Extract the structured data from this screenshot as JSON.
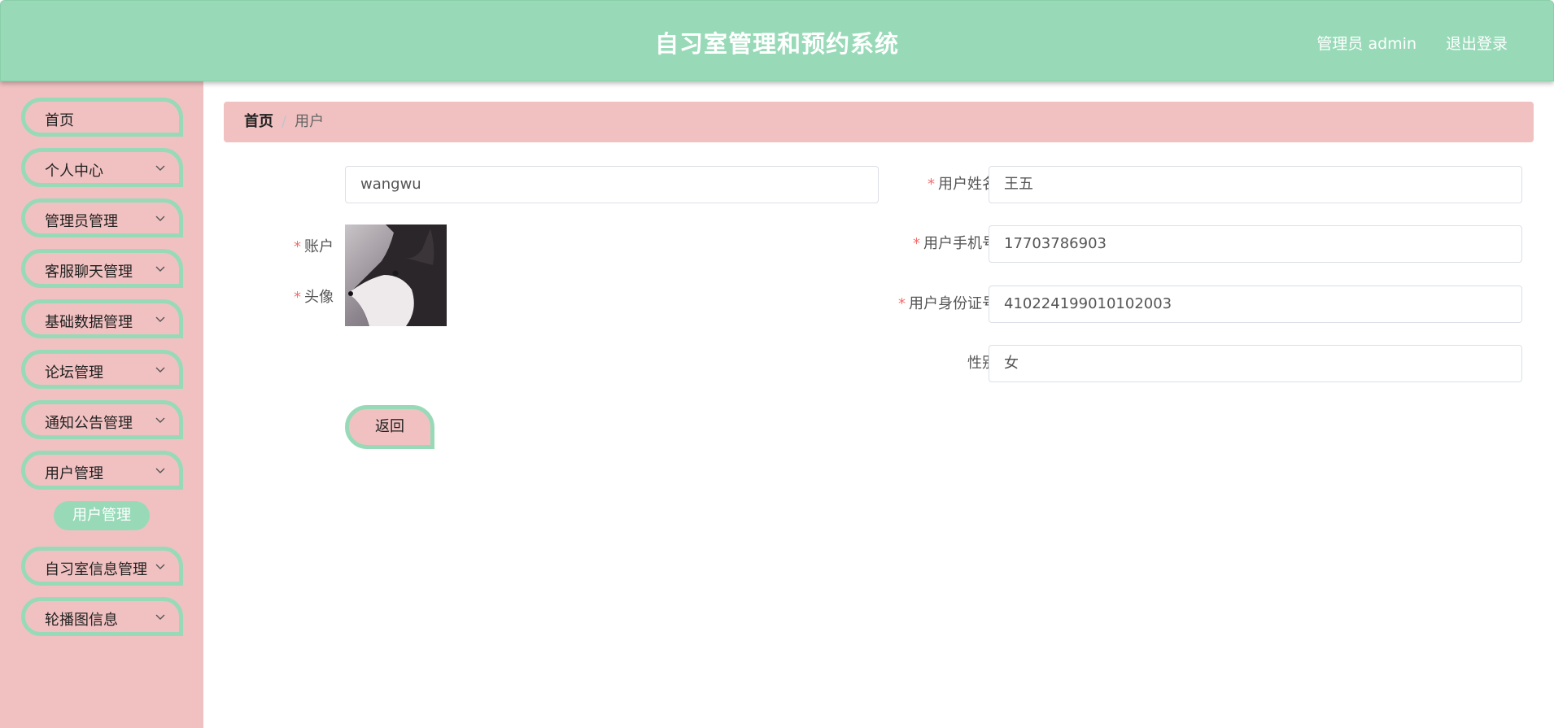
{
  "header": {
    "title": "自习室管理和预约系统",
    "user": "管理员 admin",
    "logout": "退出登录"
  },
  "sidebar": {
    "items": [
      {
        "label": "首页",
        "has_children": false
      },
      {
        "label": "个人中心",
        "has_children": true
      },
      {
        "label": "管理员管理",
        "has_children": true
      },
      {
        "label": "客服聊天管理",
        "has_children": true
      },
      {
        "label": "基础数据管理",
        "has_children": true
      },
      {
        "label": "论坛管理",
        "has_children": true
      },
      {
        "label": "通知公告管理",
        "has_children": true
      },
      {
        "label": "用户管理",
        "has_children": true
      },
      {
        "label": "自习室信息管理",
        "has_children": true
      },
      {
        "label": "轮播图信息",
        "has_children": true
      }
    ],
    "active_sub_item": "用户管理"
  },
  "breadcrumb": {
    "home": "首页",
    "separator": "/",
    "current": "用户"
  },
  "form": {
    "required_mark": "*",
    "account": {
      "label": "账户",
      "value": "wangwu"
    },
    "avatar": {
      "label": "头像"
    },
    "name": {
      "label": "用户姓名",
      "value": "王五"
    },
    "phone": {
      "label": "用户手机号",
      "value": "17703786903"
    },
    "id_card": {
      "label": "用户身份证号",
      "value": "410224199010102003"
    },
    "gender": {
      "label": "性别",
      "value": "女"
    },
    "back_button": "返回"
  },
  "colors": {
    "header_bg": "#98dab8",
    "sidebar_bg": "#f1c1c1",
    "accent_green": "#98dab8",
    "breadcrumb_bg": "#f1c1c1",
    "required": "#f56c6c"
  }
}
